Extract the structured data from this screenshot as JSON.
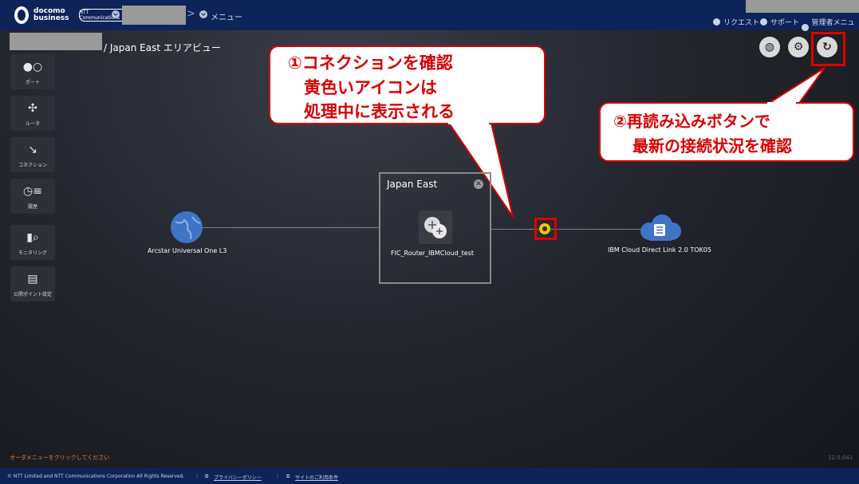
{
  "topbar": {
    "logo_line1": "docomo",
    "logo_line2": "business",
    "ntt_logo": "NTT Communications",
    "breadcrumb_separator": ">",
    "breadcrumb_menu": "メニュー",
    "nav": {
      "request": "リクエスト",
      "support": "サポート",
      "admin_menu": "管理者メニュー"
    },
    "bg_color": "#0e2459"
  },
  "sidebar": {
    "items": [
      {
        "label": "ポート",
        "icon": "port-icon"
      },
      {
        "label": "ルータ",
        "icon": "router-icon"
      },
      {
        "label": "コネクション",
        "icon": "connection-icon"
      },
      {
        "label": "履歴",
        "icon": "history-icon"
      },
      {
        "label": "モニタリング",
        "icon": "monitoring-icon"
      },
      {
        "label": "公開ポイント設定",
        "icon": "public-point-icon"
      }
    ]
  },
  "page": {
    "title": "/ Japan East エリアビュー"
  },
  "toolbar": {
    "buttons": [
      "globe-icon",
      "gear-icon",
      "refresh-icon"
    ]
  },
  "callouts": {
    "first": {
      "line1": "①コネクションを確認",
      "line2": "黄色いアイコンは",
      "line3": "処理中に表示される"
    },
    "second": {
      "line1": "②再読み込みボタンで",
      "line2": "最新の接続状況を確認"
    },
    "color": "#d80000"
  },
  "network": {
    "area_title": "Japan East",
    "nodes": {
      "left": "Arcstar Universal One L3",
      "router": "FIC_Router_IBMCloud_test",
      "right": "IBM Cloud Direct Link 2.0 TOK05"
    },
    "processing_color": "#f2c200"
  },
  "footer": {
    "order_menu": "オーダメニューをクリックしてください",
    "version": "12.0.042",
    "copyright": "© NTT Limited and NTT Communications Corporation All Rights Reserved.",
    "privacy": "プライバシーポリシー",
    "terms": "サイトのご利用条件"
  }
}
